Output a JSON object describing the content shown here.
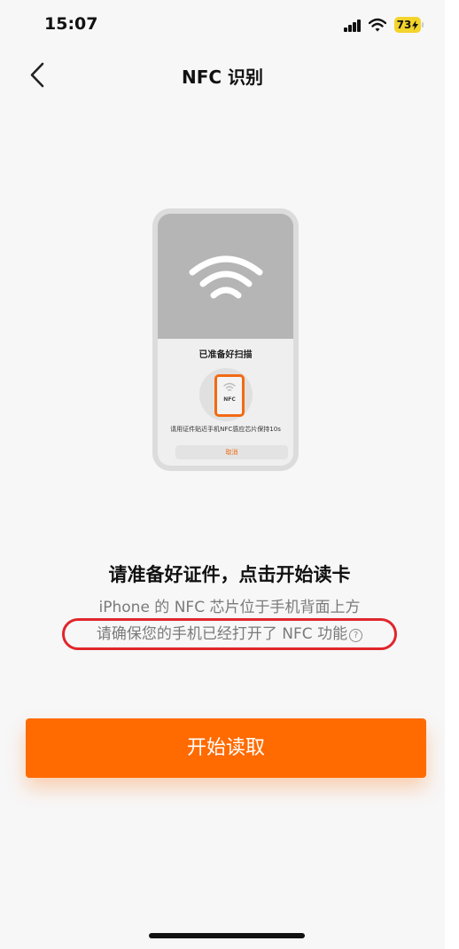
{
  "status_bar": {
    "time": "15:07",
    "battery_level": "73",
    "icons": [
      "signal-icon",
      "wifi-icon",
      "battery-charging-icon"
    ]
  },
  "nav": {
    "back_icon": "chevron-left-icon",
    "title": "NFC 识别"
  },
  "illustration": {
    "sheet_title": "已准备好扫描",
    "mini_phone_label": "NFC",
    "hint": "请用证件贴近手机NFC感应芯片保持10s",
    "cancel": "取消"
  },
  "content": {
    "headline": "请准备好证件，点击开始读卡",
    "line1": "iPhone 的 NFC 芯片位于手机背面上方",
    "line2": "请确保您的手机已经打开了 NFC 功能",
    "help_icon": "question-circle-icon",
    "help_glyph": "?"
  },
  "actions": {
    "start_label": "开始读取"
  },
  "colors": {
    "accent": "#ff6b00",
    "annotation_circle": "#e0262b",
    "battery": "#f3d42b"
  }
}
